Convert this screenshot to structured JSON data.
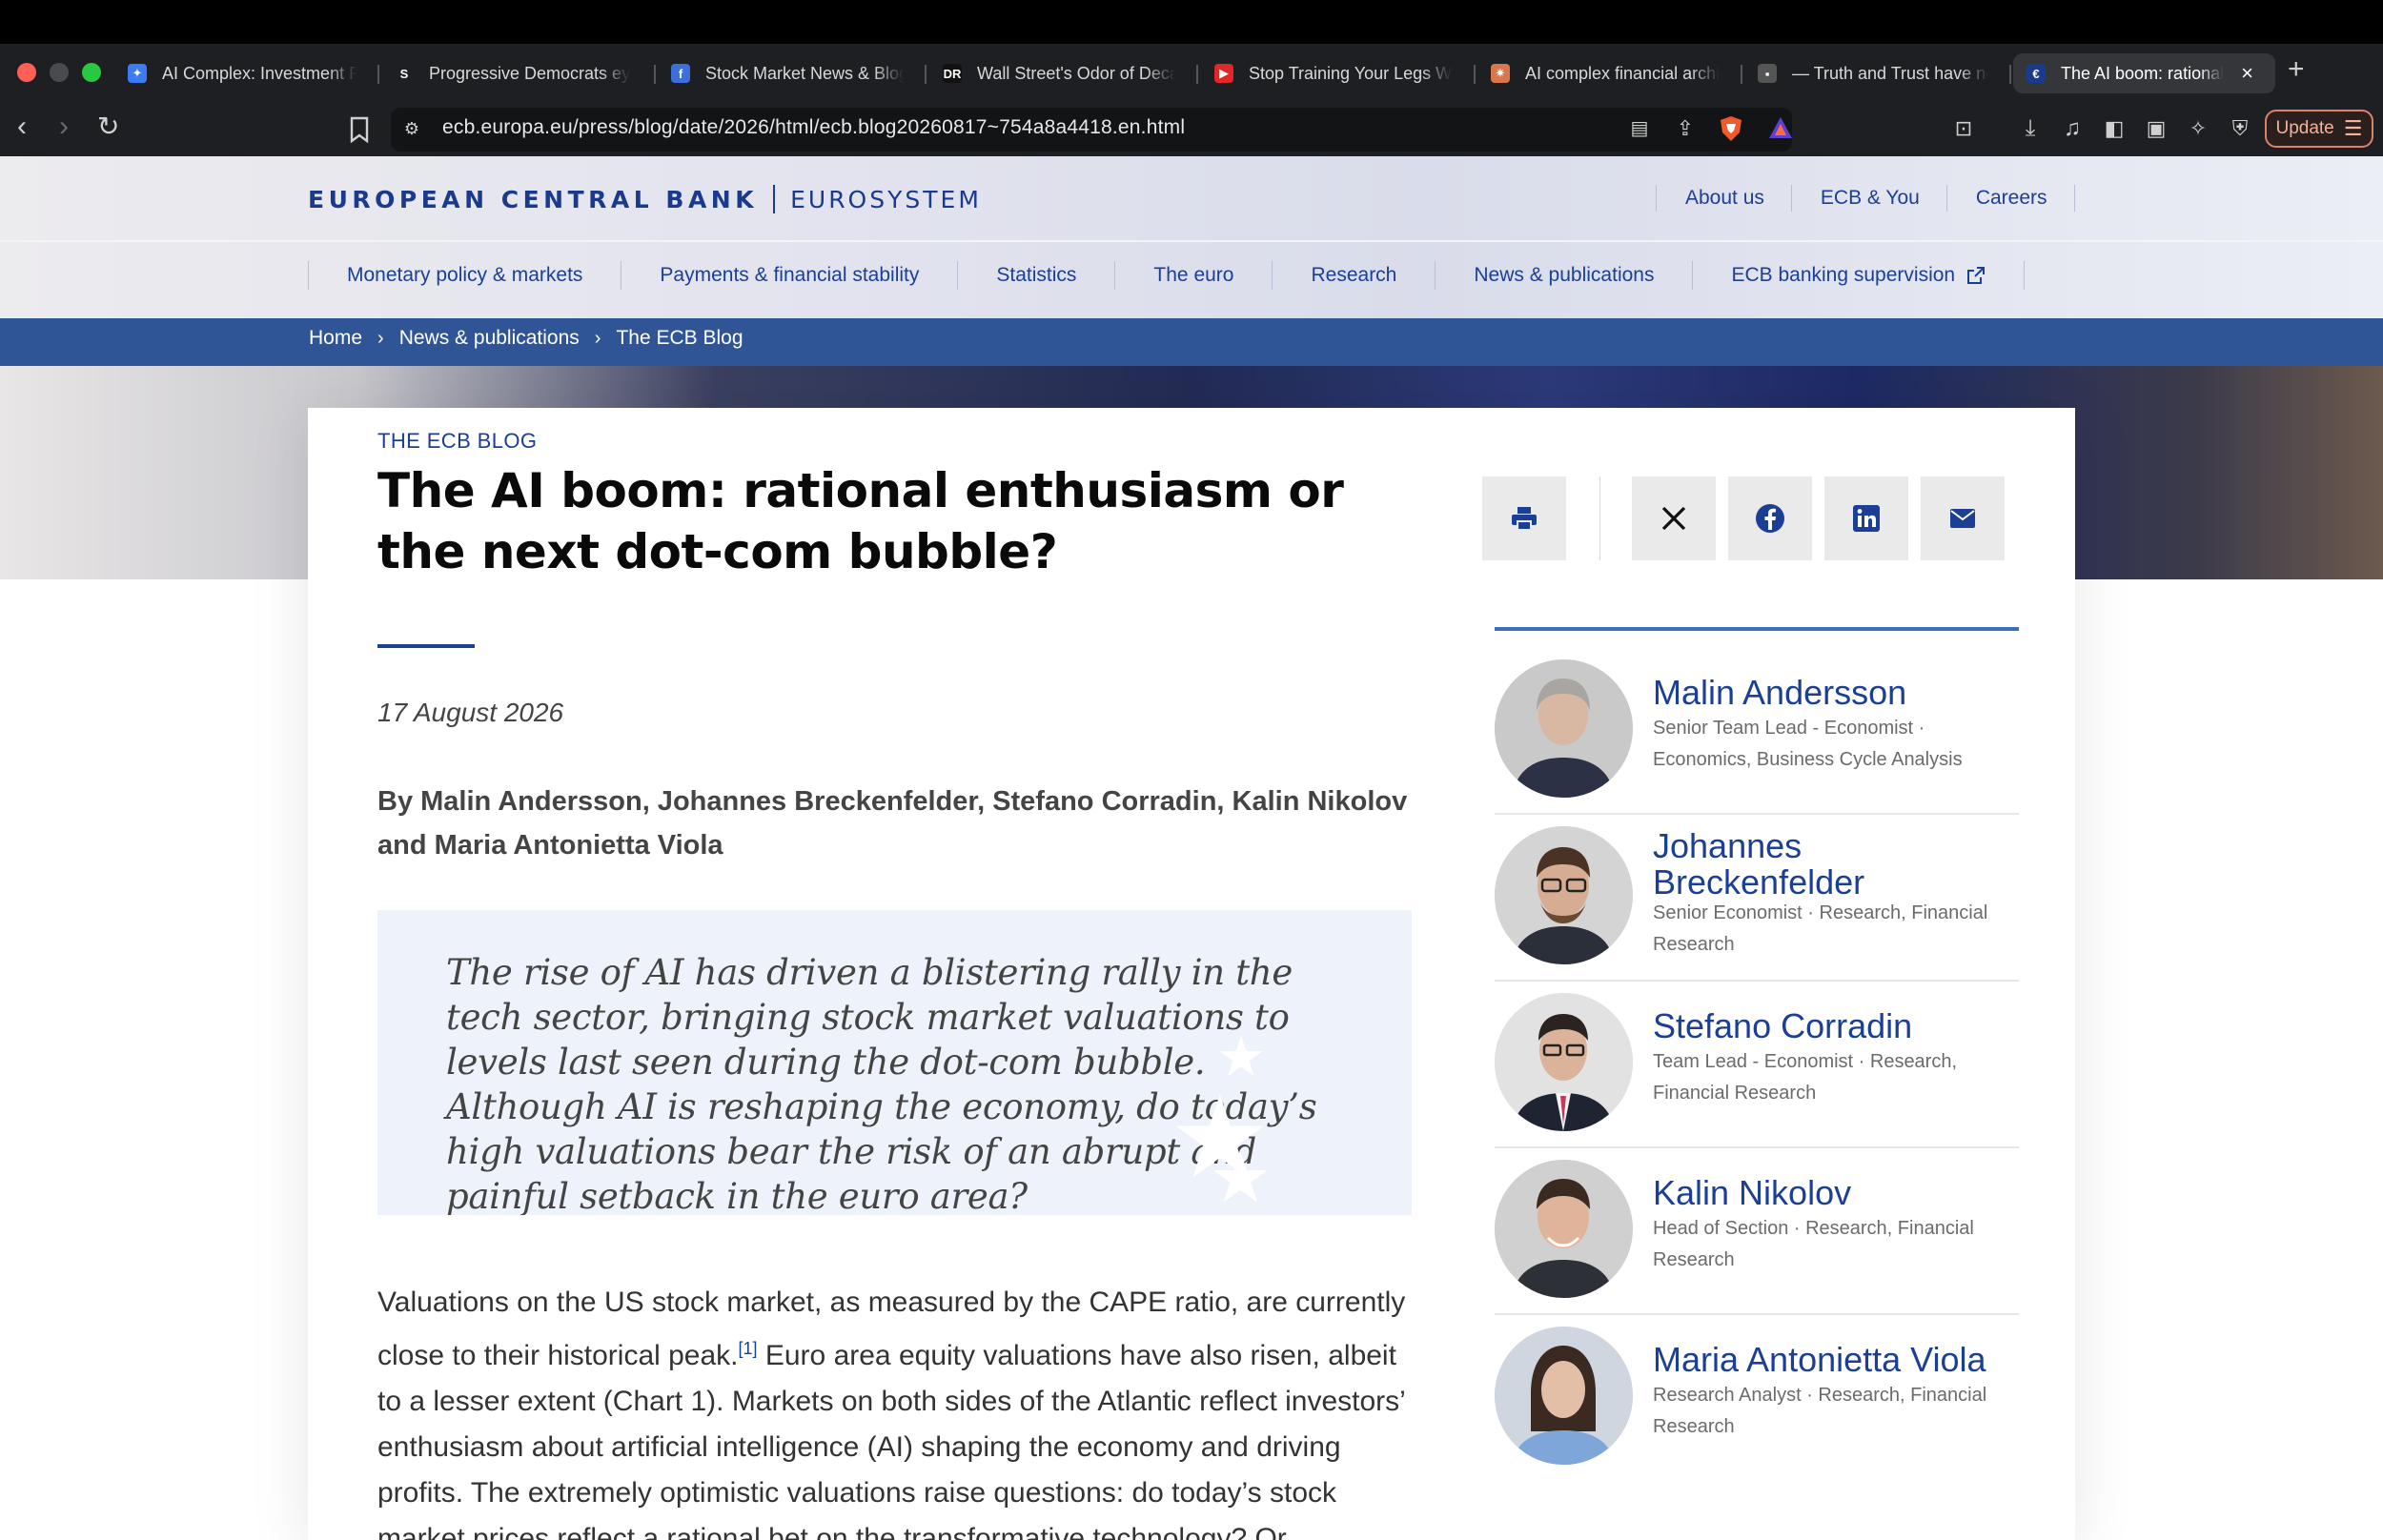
{
  "browser": {
    "tabs": [
      {
        "title": "AI Complex: Investment Ri",
        "favicon_color": "#3c7bf5",
        "favicon_glyph": "✦"
      },
      {
        "title": "Progressive Democrats ey",
        "favicon_color": "#1e1f22",
        "favicon_glyph": "S"
      },
      {
        "title": "Stock Market News & Blog",
        "favicon_color": "#3d6fd8",
        "favicon_glyph": "f"
      },
      {
        "title": "Wall Street's Odor of Deca",
        "favicon_color": "#111111",
        "favicon_glyph": "DR"
      },
      {
        "title": "Stop Training Your Legs W",
        "favicon_color": "#e02828",
        "favicon_glyph": "▶"
      },
      {
        "title": "AI complex financial archit",
        "favicon_color": "#d9774b",
        "favicon_glyph": "✷"
      },
      {
        "title": "— Truth and Trust have no",
        "favicon_color": "#555555",
        "favicon_glyph": "▪"
      },
      {
        "title": "The AI boom: rational",
        "favicon_color": "#1a3a8e",
        "favicon_glyph": "€"
      }
    ],
    "url": "ecb.europa.eu/press/blog/date/2026/html/ecb.blog20260817~754a8a4418.en.html",
    "update_label": "Update"
  },
  "header": {
    "logo_primary": "EUROPEAN CENTRAL BANK",
    "logo_secondary": "EUROSYSTEM",
    "top_links": [
      "About us",
      "ECB & You",
      "Careers"
    ],
    "nav": [
      "Monetary policy & markets",
      "Payments & financial stability",
      "Statistics",
      "The euro",
      "Research",
      "News & publications",
      "ECB banking supervision"
    ]
  },
  "breadcrumb": [
    "Home",
    "News & publications",
    "The ECB Blog"
  ],
  "article": {
    "kicker": "THE ECB BLOG",
    "title": "The AI boom: rational enthusiasm or the next dot-com bubble?",
    "date": "17 August 2026",
    "byline": "By Malin Andersson, Johannes Breckenfelder, Stefano Corradin, Kalin Nikolov and Maria Antonietta Viola",
    "quote": "The rise of AI has driven a blistering rally in the tech sector, bringing stock market valuations to levels last seen during the dot-com bubble. Although AI is reshaping the economy, do today’s high valuations bear the risk of an abrupt and painful setback in the euro area?",
    "body_part1": "Valuations on the US stock market, as measured by the CAPE ratio, are currently close to their historical peak.",
    "footnote": "[1]",
    "body_part2": " Euro area equity valuations have also risen, albeit to a lesser extent (Chart 1). Markets on both sides of the Atlantic reflect investors’ enthusiasm about artificial intelligence (AI) shaping the economy and driving profits. The extremely optimistic valuations raise questions: do today’s stock market prices reflect a rational bet on the transformative technology? Or"
  },
  "authors": [
    {
      "name": "Malin Andersson",
      "desc": "Senior Team Lead - Economist · Economics, Business Cycle Analysis"
    },
    {
      "name": "Johannes Breckenfelder",
      "desc": "Senior Economist · Research, Financial Research"
    },
    {
      "name": "Stefano Corradin",
      "desc": "Team Lead - Economist · Research, Financial Research"
    },
    {
      "name": "Kalin Nikolov",
      "desc": "Head of Section · Research, Financial Research"
    },
    {
      "name": "Maria Antonietta Viola",
      "desc": "Research Analyst · Research, Financial Research"
    }
  ],
  "colors": {
    "ecb_blue": "#1b3f95",
    "breadcrumb_bg": "#305597",
    "quote_bg": "#eef3fb"
  }
}
